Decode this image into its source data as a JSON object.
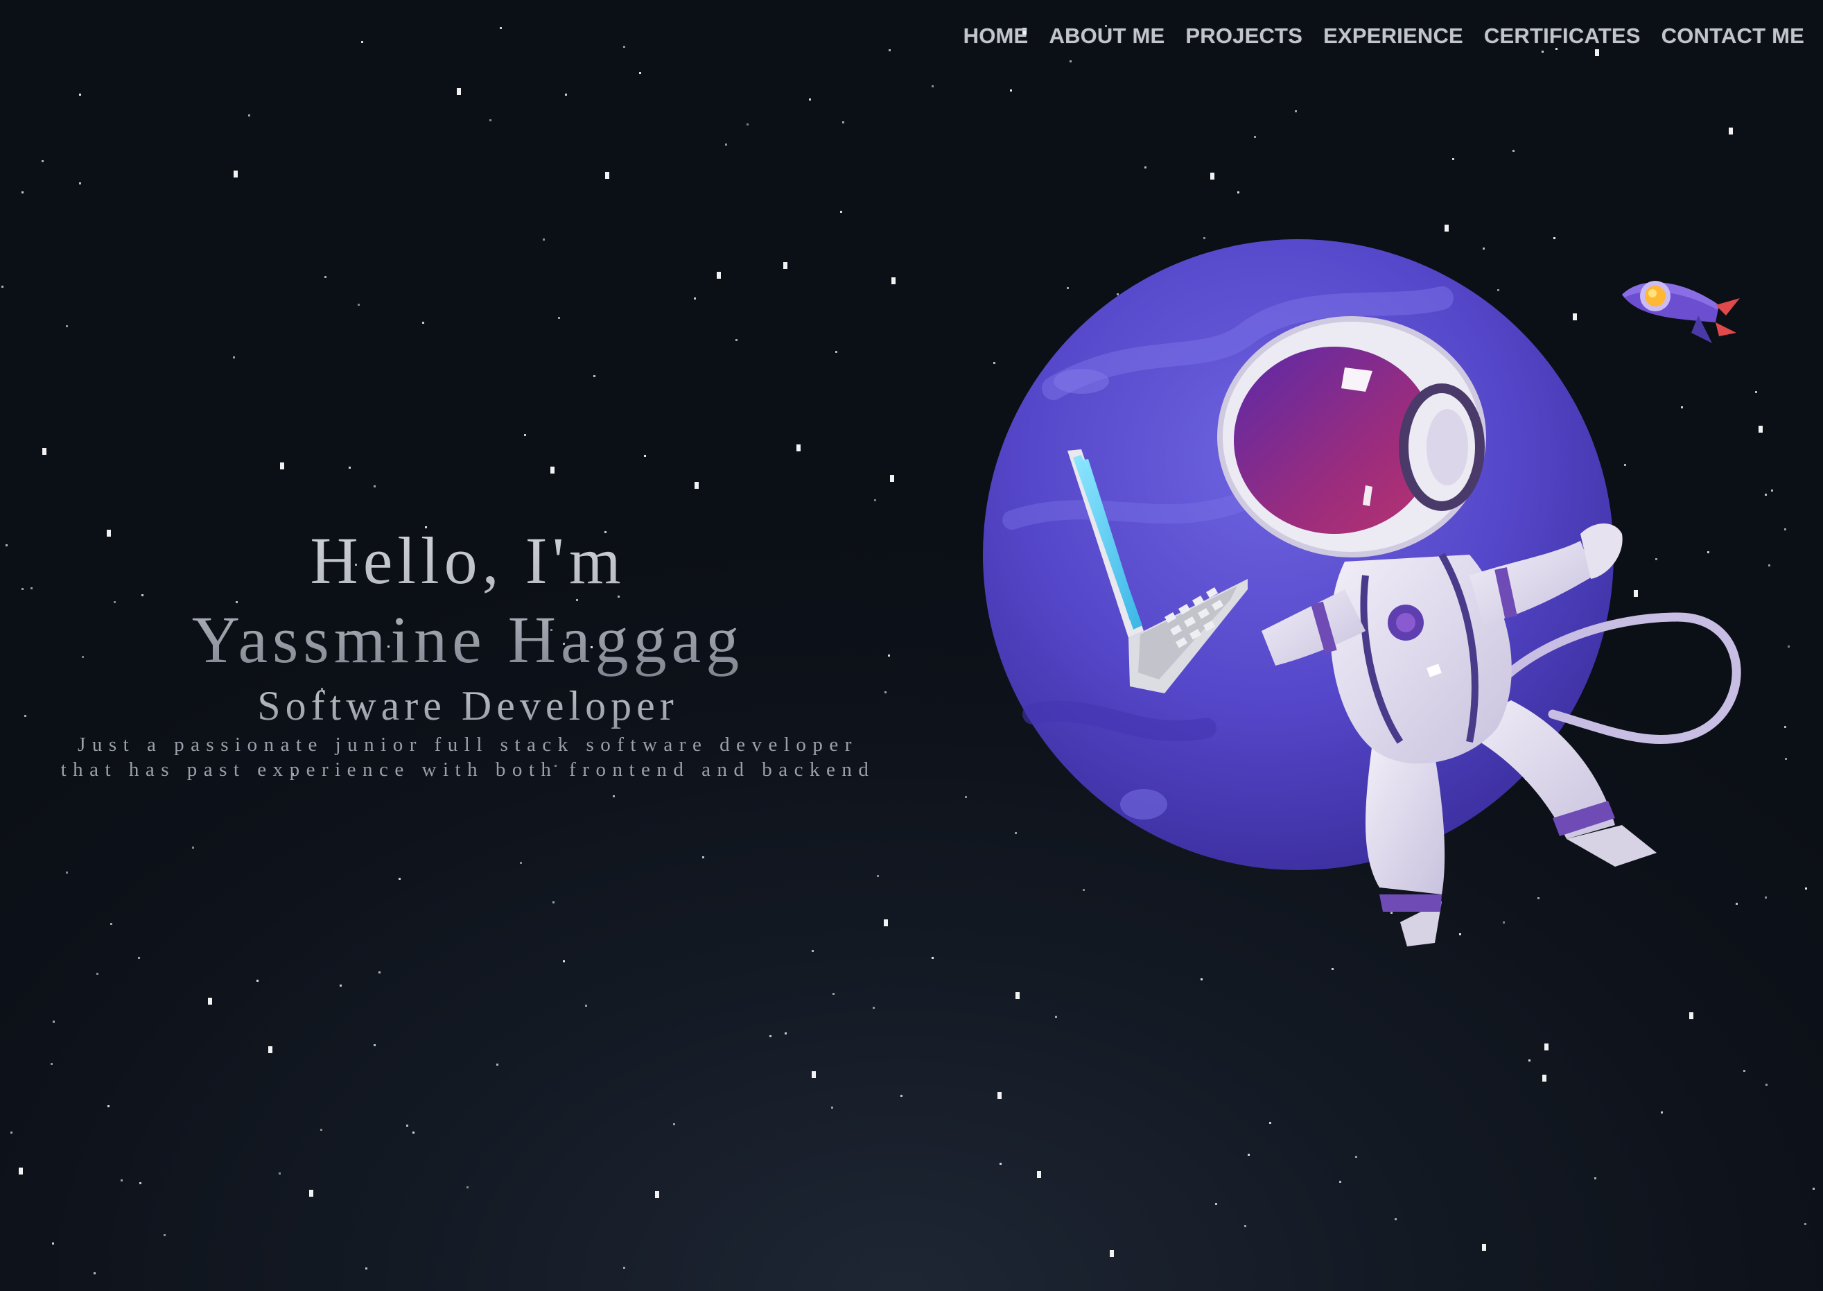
{
  "nav": {
    "items": [
      {
        "label": "HOME",
        "name": "nav-home"
      },
      {
        "label": "ABOUT ME",
        "name": "nav-about-me"
      },
      {
        "label": "PROJECTS",
        "name": "nav-projects"
      },
      {
        "label": "EXPERIENCE",
        "name": "nav-experience"
      },
      {
        "label": "CERTIFICATES",
        "name": "nav-certificates"
      },
      {
        "label": "CONTACT ME",
        "name": "nav-contact-me"
      }
    ]
  },
  "hero": {
    "greeting": "Hello, I'm",
    "name": "Yassmine Haggag",
    "role": "Software Developer",
    "description_line1": "Just a passionate junior full stack software developer",
    "description_line2": "that has past experience with both frontend and backend"
  },
  "illustration": {
    "subject": "astronaut-with-laptop-on-planet",
    "rocket": "rocket-icon"
  },
  "colors": {
    "background": "#0e121b",
    "nav_text": "#c2c5cc",
    "planet": "#5b4fcf",
    "planet_dark": "#3f33a8",
    "visor": "#8a2a86",
    "laptop_screen": "#5fd0f0",
    "star": "#ffffff"
  }
}
